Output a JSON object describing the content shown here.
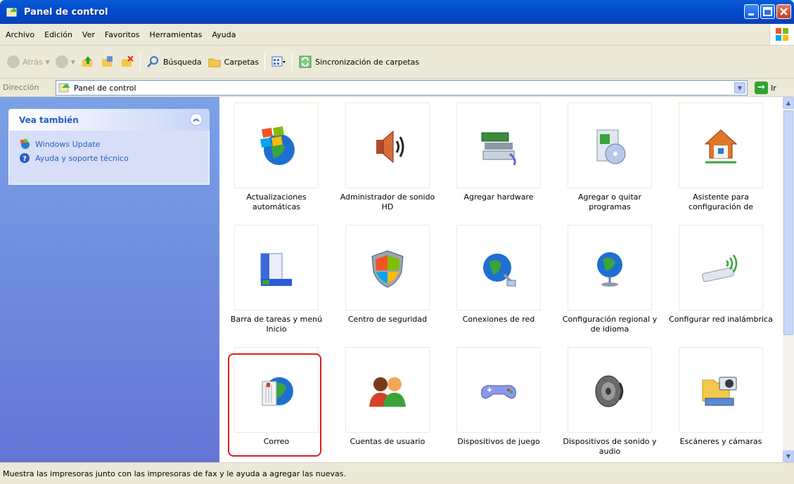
{
  "window": {
    "title": "Panel de control"
  },
  "menu": [
    "Archivo",
    "Edición",
    "Ver",
    "Favoritos",
    "Herramientas",
    "Ayuda"
  ],
  "toolbar": {
    "back_label": "Atrás",
    "search_label": "Búsqueda",
    "folders_label": "Carpetas",
    "sync_label": "Sincronización de carpetas"
  },
  "address": {
    "label": "Dirección",
    "value": "Panel de control",
    "go_label": "Ir"
  },
  "taskpane": {
    "title": "Vea también",
    "links": [
      "Windows Update",
      "Ayuda y soporte técnico"
    ]
  },
  "items": [
    {
      "label": "Actualizaciones automáticas",
      "icon": "windows-update-icon"
    },
    {
      "label": "Administrador de sonido HD",
      "icon": "speaker-icon"
    },
    {
      "label": "Agregar hardware",
      "icon": "hardware-icon"
    },
    {
      "label": "Agregar o quitar programas",
      "icon": "add-remove-programs-icon"
    },
    {
      "label": "Asistente para configuración de",
      "icon": "network-wizard-icon"
    },
    {
      "label": "Barra de tareas y menú Inicio",
      "icon": "taskbar-icon"
    },
    {
      "label": "Centro de seguridad",
      "icon": "shield-icon"
    },
    {
      "label": "Conexiones de red",
      "icon": "network-globe-icon"
    },
    {
      "label": "Configuración regional y de idioma",
      "icon": "regional-globe-icon"
    },
    {
      "label": "Configurar red inalámbrica",
      "icon": "wireless-icon"
    },
    {
      "label": "Correo",
      "icon": "mail-icon"
    },
    {
      "label": "Cuentas de usuario",
      "icon": "users-icon"
    },
    {
      "label": "Dispositivos de juego",
      "icon": "gamepad-icon"
    },
    {
      "label": "Dispositivos de sonido y audio",
      "icon": "audio-speaker-icon"
    },
    {
      "label": "Escáneres y cámaras",
      "icon": "scanner-camera-icon"
    }
  ],
  "status": {
    "text": "Muestra las impresoras junto con las impresoras de fax y le ayuda a agregar las nuevas."
  }
}
